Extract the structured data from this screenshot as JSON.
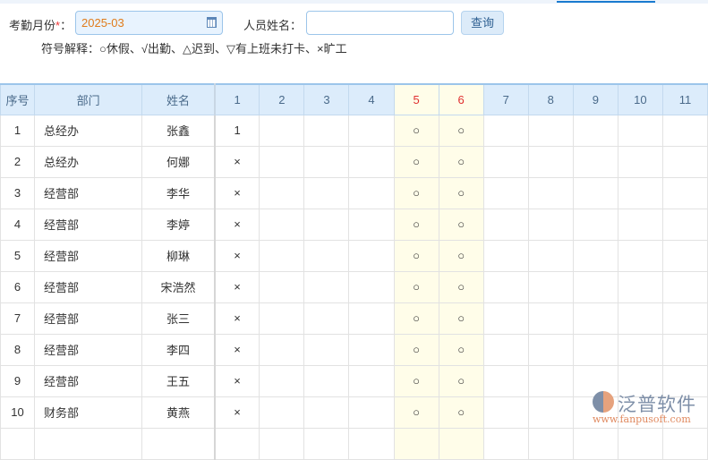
{
  "form": {
    "month_label": "考勤月份",
    "required_mark": "*",
    "colon": "：",
    "month_value": "2025-03",
    "name_label": "人员姓名：",
    "name_value": "",
    "search_label": "查询",
    "legend": "符号解释：○休假、√出勤、△迟到、▽有上班未打卡、×旷工"
  },
  "table": {
    "headers": {
      "index": "序号",
      "dept": "部门",
      "name": "姓名",
      "days": [
        "1",
        "2",
        "3",
        "4",
        "5",
        "6",
        "7",
        "8",
        "9",
        "10",
        "11"
      ]
    },
    "weekend_days": [
      "5",
      "6"
    ],
    "rows": [
      {
        "index": "1",
        "dept": "总经办",
        "name": "张鑫",
        "days": [
          "1",
          "",
          "",
          "",
          "○",
          "○",
          "",
          "",
          "",
          "",
          ""
        ]
      },
      {
        "index": "2",
        "dept": "总经办",
        "name": "何娜",
        "days": [
          "×",
          "",
          "",
          "",
          "○",
          "○",
          "",
          "",
          "",
          "",
          ""
        ]
      },
      {
        "index": "3",
        "dept": "经营部",
        "name": "李华",
        "days": [
          "×",
          "",
          "",
          "",
          "○",
          "○",
          "",
          "",
          "",
          "",
          ""
        ]
      },
      {
        "index": "4",
        "dept": "经营部",
        "name": "李婷",
        "days": [
          "×",
          "",
          "",
          "",
          "○",
          "○",
          "",
          "",
          "",
          "",
          ""
        ]
      },
      {
        "index": "5",
        "dept": "经营部",
        "name": "柳琳",
        "days": [
          "×",
          "",
          "",
          "",
          "○",
          "○",
          "",
          "",
          "",
          "",
          ""
        ]
      },
      {
        "index": "6",
        "dept": "经营部",
        "name": "宋浩然",
        "days": [
          "×",
          "",
          "",
          "",
          "○",
          "○",
          "",
          "",
          "",
          "",
          ""
        ]
      },
      {
        "index": "7",
        "dept": "经营部",
        "name": "张三",
        "days": [
          "×",
          "",
          "",
          "",
          "○",
          "○",
          "",
          "",
          "",
          "",
          ""
        ]
      },
      {
        "index": "8",
        "dept": "经营部",
        "name": "李四",
        "days": [
          "×",
          "",
          "",
          "",
          "○",
          "○",
          "",
          "",
          "",
          "",
          ""
        ]
      },
      {
        "index": "9",
        "dept": "经营部",
        "name": "王五",
        "days": [
          "×",
          "",
          "",
          "",
          "○",
          "○",
          "",
          "",
          "",
          "",
          ""
        ]
      },
      {
        "index": "10",
        "dept": "财务部",
        "name": "黄燕",
        "days": [
          "×",
          "",
          "",
          "",
          "○",
          "○",
          "",
          "",
          "",
          "",
          ""
        ]
      }
    ]
  },
  "watermark": {
    "brand": "泛普软件",
    "url": "www.fanpusoft.com"
  }
}
